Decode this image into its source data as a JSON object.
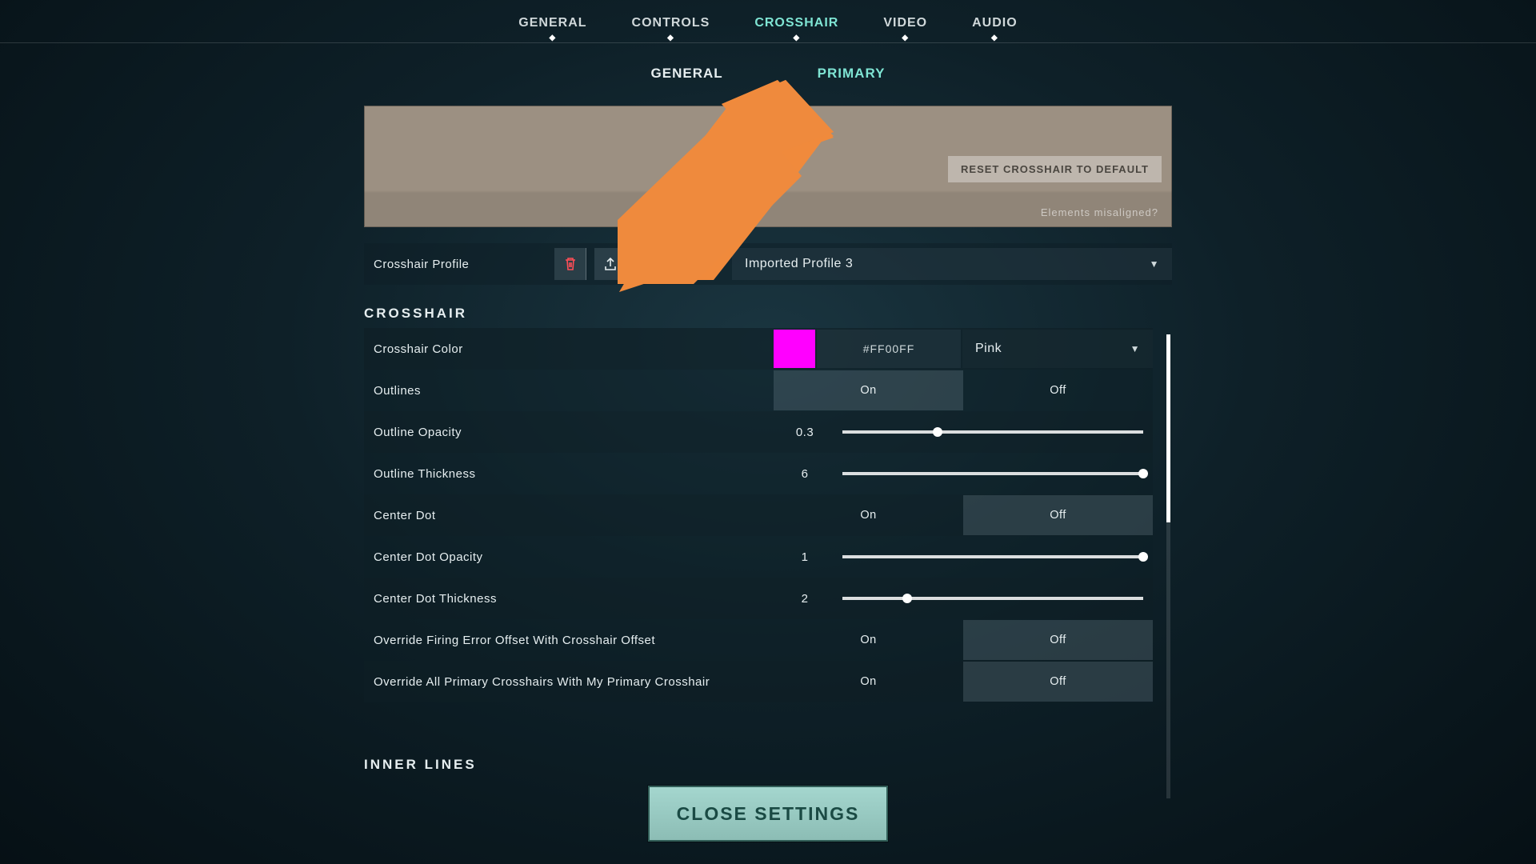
{
  "topnav": {
    "tabs": [
      "GENERAL",
      "CONTROLS",
      "CROSSHAIR",
      "VIDEO",
      "AUDIO"
    ],
    "active_index": 2
  },
  "subnav": {
    "tabs": [
      "GENERAL",
      "PRIMARY"
    ],
    "active_index": 1
  },
  "preview": {
    "reset_label": "RESET CROSSHAIR TO DEFAULT",
    "misaligned_label": "Elements misaligned?"
  },
  "profile_bar": {
    "label": "Crosshair Profile",
    "selected": "Imported Profile 3"
  },
  "icons": {
    "delete": "delete-icon",
    "export": "export-icon",
    "copy": "copy-icon",
    "import_code": "import-code-icon"
  },
  "sections": {
    "crosshair_title": "CROSSHAIR",
    "inner_lines_title": "INNER LINES"
  },
  "rows": {
    "crosshair_color": {
      "label": "Crosshair Color",
      "hex": "#FF00FF",
      "color_name": "Pink",
      "swatch": "#ff00ff"
    },
    "outlines": {
      "label": "Outlines",
      "on": "On",
      "off": "Off",
      "value": "On"
    },
    "outline_opacity": {
      "label": "Outline Opacity",
      "value": "0.3",
      "percent": 30
    },
    "outline_thickness": {
      "label": "Outline Thickness",
      "value": "6",
      "percent": 100
    },
    "center_dot": {
      "label": "Center Dot",
      "on": "On",
      "off": "Off",
      "value": "Off"
    },
    "center_dot_opacity": {
      "label": "Center Dot Opacity",
      "value": "1",
      "percent": 100
    },
    "center_dot_thickness": {
      "label": "Center Dot Thickness",
      "value": "2",
      "percent": 20
    },
    "override_firing": {
      "label": "Override Firing Error Offset With Crosshair Offset",
      "on": "On",
      "off": "Off",
      "value": "Off"
    },
    "override_all": {
      "label": "Override All Primary Crosshairs With My Primary Crosshair",
      "on": "On",
      "off": "Off",
      "value": "Off"
    }
  },
  "close_button": "CLOSE SETTINGS"
}
